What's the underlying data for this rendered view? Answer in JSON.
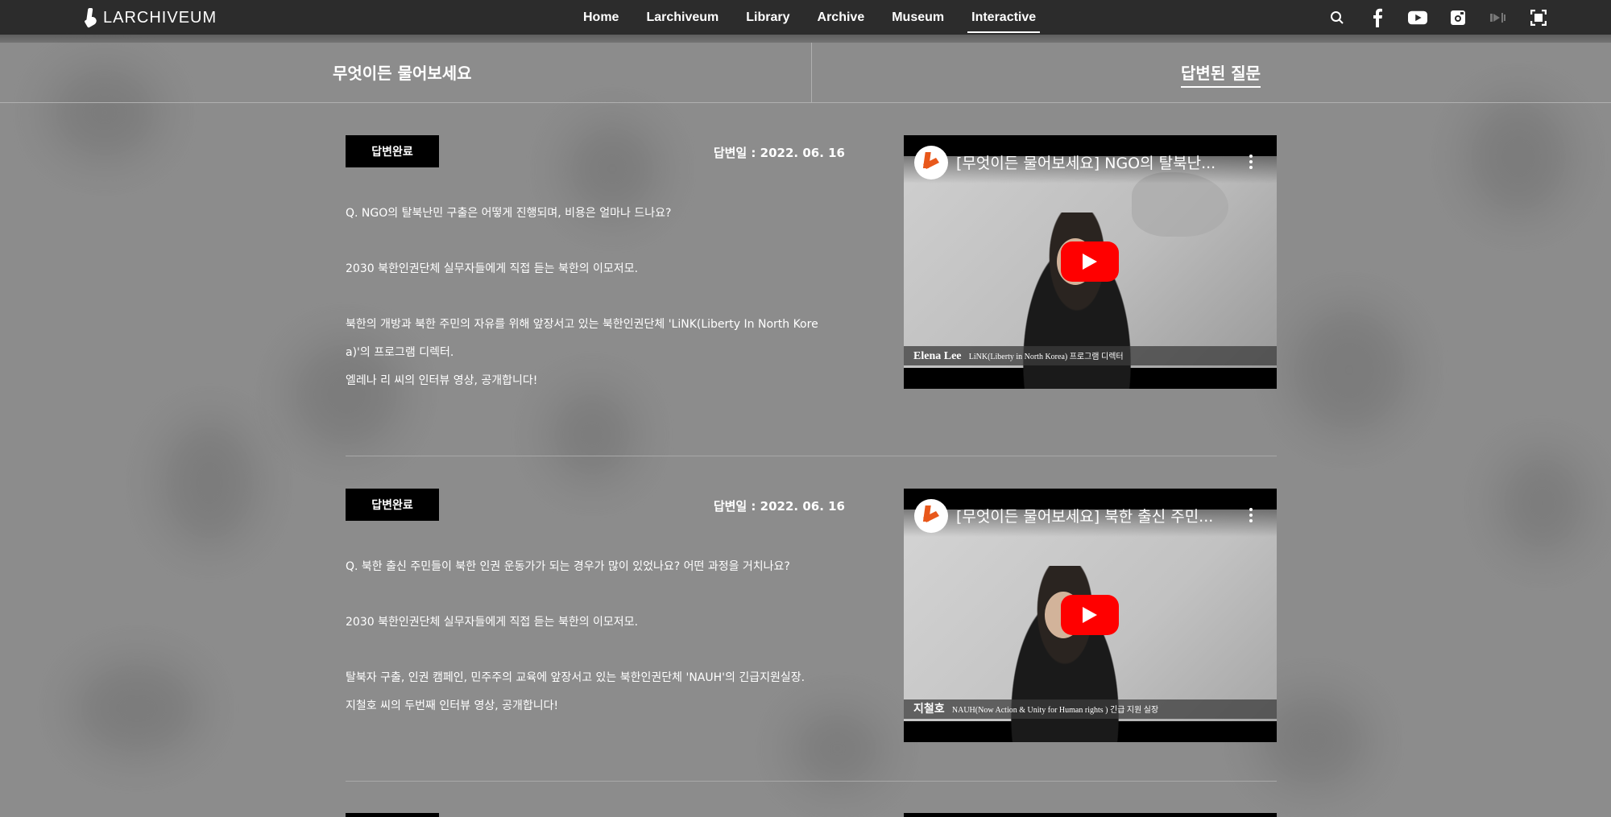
{
  "nav": {
    "logo": "LARCHIVEUM",
    "links": [
      "Home",
      "Larchiveum",
      "Library",
      "Archive",
      "Museum",
      "Interactive"
    ],
    "active": "Interactive",
    "icons": [
      "search-icon",
      "facebook-icon",
      "youtube-icon",
      "instagram-icon",
      "audio-icon",
      "fullscreen-icon"
    ]
  },
  "subheader": {
    "left_title": "무엇이든 물어보세요",
    "right_title": "답변된 질문"
  },
  "entries": [
    {
      "badge": "답변완료",
      "date": "답변일 : 2022. 06. 16",
      "question": "Q. NGO의 탈북난민 구출은 어떻게 진행되며, 비용은 얼마나 드나요?",
      "line2": "2030 북한인권단체 실무자들에게 직접 듣는 북한의 이모저모.",
      "line3a": "북한의 개방과 북한 주민의 자유를 위해 앞장서고 있는 북한인권단체 'LiNK(Liberty In North Kore",
      "line3b": "a)'의 프로그램 디렉터.",
      "line4": "엘레나 리 씨의 인터뷰 영상, 공개합니다!",
      "video": {
        "title": "[무엇이든 물어보세요] NGO의 탈북난...",
        "caption_name": "Elena Lee",
        "caption_role": "LiNK(Liberty in North Korea) 프로그램 디렉터"
      }
    },
    {
      "badge": "답변완료",
      "date": "답변일 : 2022. 06. 16",
      "question": "Q. 북한 출신 주민들이 북한 인권 운동가가 되는 경우가 많이 있었나요? 어떤 과정을 거치나요?",
      "line2": "2030 북한인권단체 실무자들에게 직접 듣는 북한의 이모저모.",
      "line3a": "탈북자 구출, 인권 캠페인, 민주주의 교육에 앞장서고 있는 북한인권단체 'NAUH'의 긴급지원실장.",
      "line4": "지철호 씨의 두번째 인터뷰 영상, 공개합니다!",
      "video": {
        "title": "[무엇이든 물어보세요] 북한 출신 주민...",
        "caption_name": "지철호",
        "caption_role": "NAUH(Now Action & Unity for Human rights ) 긴급 지원 실장"
      }
    }
  ],
  "colors": {
    "nav_bg": "#2c2c2c",
    "page_bg": "#8c8c8c",
    "badge_bg": "#000000",
    "play_button": "#ff0000"
  }
}
